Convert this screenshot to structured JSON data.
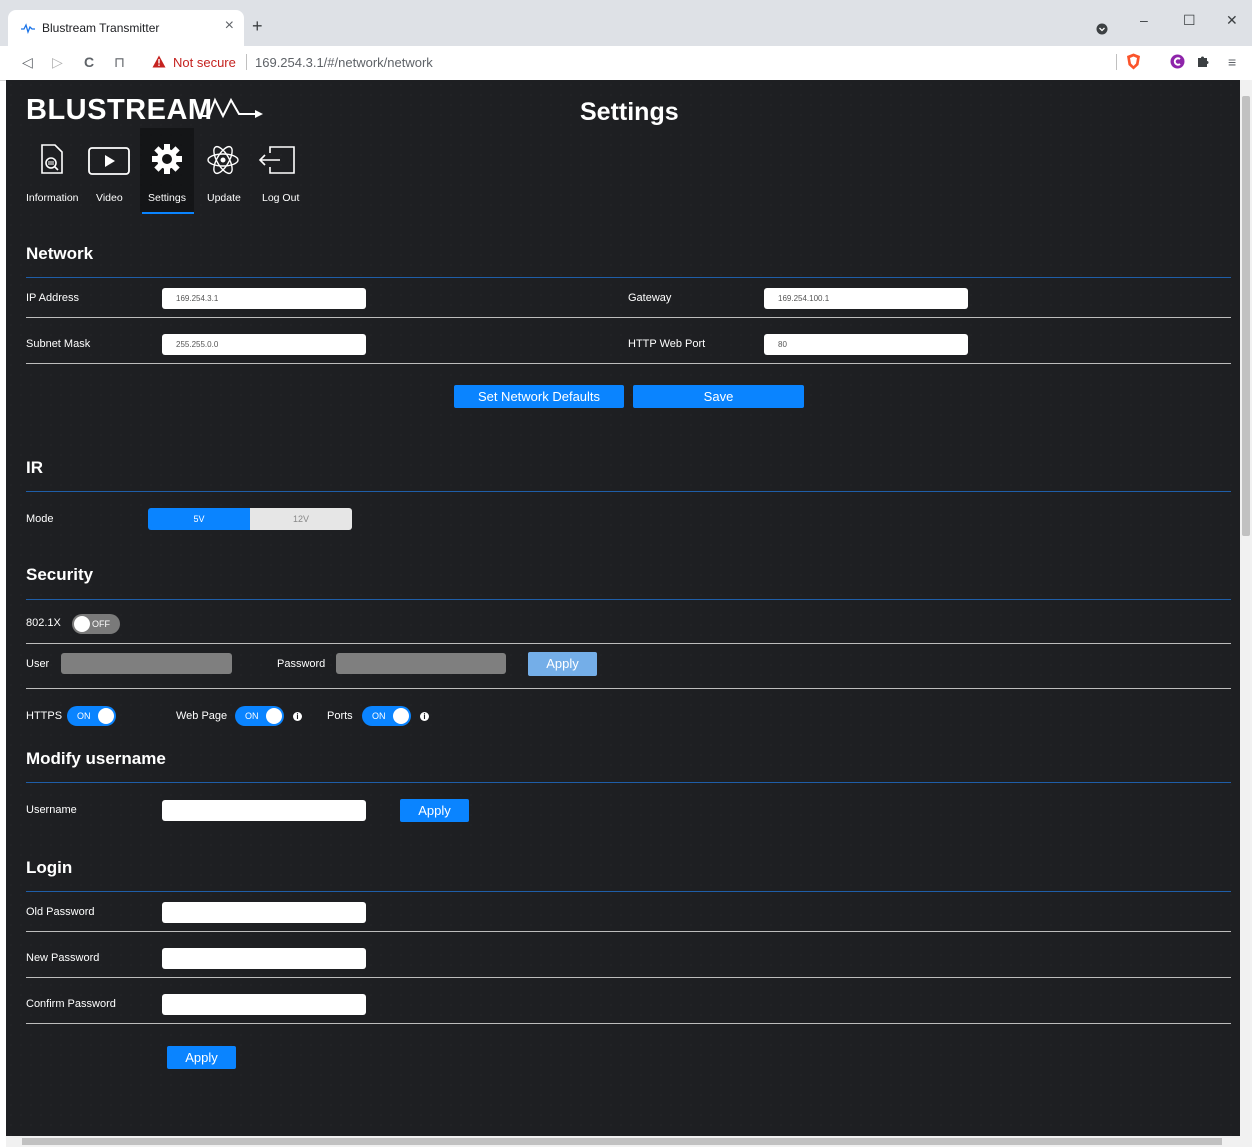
{
  "browser": {
    "tab_title": "Blustream Transmitter",
    "tab_close": "×",
    "new_tab": "+",
    "not_secure": "Not secure",
    "url": "169.254.3.1/#/network/network",
    "win_min": "–",
    "win_max": "☐",
    "win_close": "✕",
    "nav_back": "◁",
    "nav_forward": "▷",
    "nav_reload": "C",
    "nav_bookmark": "⊓",
    "menu": "≡"
  },
  "header": {
    "logo_text": "BLUSTREAM",
    "page_title": "Settings"
  },
  "nav": {
    "items": [
      {
        "label": "Information",
        "icon": "document-search-icon"
      },
      {
        "label": "Video",
        "icon": "play-screen-icon"
      },
      {
        "label": "Settings",
        "icon": "gear-icon"
      },
      {
        "label": "Update",
        "icon": "atom-icon"
      },
      {
        "label": "Log Out",
        "icon": "logout-icon"
      }
    ],
    "active": "Settings"
  },
  "network": {
    "title": "Network",
    "ip_label": "IP Address",
    "ip_value": "169.254.3.1",
    "gateway_label": "Gateway",
    "gateway_value": "169.254.100.1",
    "subnet_label": "Subnet Mask",
    "subnet_value": "255.255.0.0",
    "port_label": "HTTP Web Port",
    "port_value": "80",
    "defaults_button": "Set Network Defaults",
    "save_button": "Save"
  },
  "ir": {
    "title": "IR",
    "mode_label": "Mode",
    "options": [
      "5V",
      "12V"
    ],
    "selected": "5V"
  },
  "security": {
    "title": "Security",
    "dot1x_label": "802.1X",
    "dot1x_state": "OFF",
    "user_label": "User",
    "password_label": "Password",
    "apply_button": "Apply",
    "https_label": "HTTPS",
    "https_state": "ON",
    "webpage_label": "Web Page",
    "webpage_state": "ON",
    "ports_label": "Ports",
    "ports_state": "ON",
    "info_glyph": "i"
  },
  "modify_username": {
    "title": "Modify username",
    "username_label": "Username",
    "apply_button": "Apply"
  },
  "login": {
    "title": "Login",
    "old_label": "Old Password",
    "new_label": "New Password",
    "confirm_label": "Confirm Password",
    "apply_button": "Apply"
  },
  "colors": {
    "accent": "#0a84ff",
    "background": "#1e1f22",
    "section_line": "#1f5ea8"
  }
}
